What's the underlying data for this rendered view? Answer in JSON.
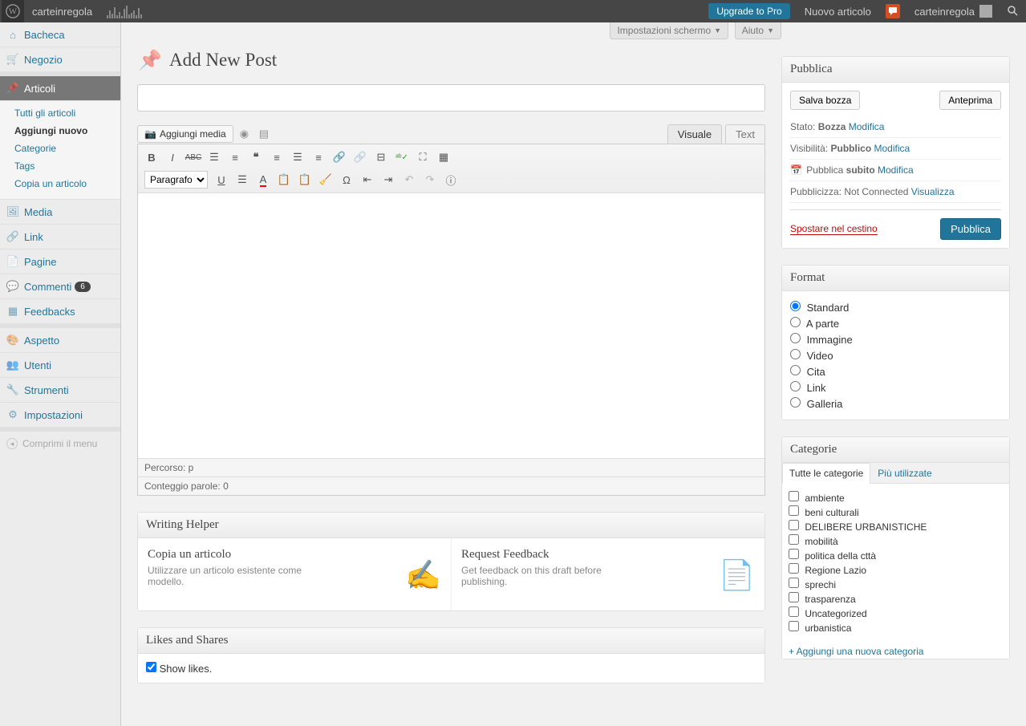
{
  "adminbar": {
    "sitename": "carteinregola",
    "upgrade": "Upgrade to Pro",
    "new_post": "Nuovo articolo",
    "username": "carteinregola"
  },
  "screen_meta": {
    "options": "Impostazioni schermo",
    "help": "Aiuto"
  },
  "sidebar": {
    "bacheca": "Bacheca",
    "negozio": "Negozio",
    "articoli": "Articoli",
    "sub_all": "Tutti gli articoli",
    "sub_add": "Aggiungi nuovo",
    "sub_cat": "Categorie",
    "sub_tags": "Tags",
    "sub_copy": "Copia un articolo",
    "media": "Media",
    "link": "Link",
    "pagine": "Pagine",
    "commenti": "Commenti",
    "commenti_count": "6",
    "feedbacks": "Feedbacks",
    "aspetto": "Aspetto",
    "utenti": "Utenti",
    "strumenti": "Strumenti",
    "impostazioni": "Impostazioni",
    "collapse": "Comprimi il menu"
  },
  "page": {
    "title": "Add New Post",
    "title_placeholder": ""
  },
  "editor": {
    "add_media": "Aggiungi media",
    "tab_visual": "Visuale",
    "tab_text": "Text",
    "paragraph": "Paragrafo",
    "path_label": "Percorso: p",
    "wordcount": "Conteggio parole: 0"
  },
  "writing_helper": {
    "title": "Writing Helper",
    "copy_title": "Copia un articolo",
    "copy_desc": "Utilizzare un articolo esistente come modello.",
    "feedback_title": "Request Feedback",
    "feedback_desc": "Get feedback on this draft before publishing."
  },
  "likes": {
    "title": "Likes and Shares",
    "show_likes": "Show likes."
  },
  "publish": {
    "title": "Pubblica",
    "save_draft": "Salva bozza",
    "preview": "Anteprima",
    "status_label": "Stato:",
    "status_value": "Bozza",
    "visibility_label": "Visibilità:",
    "visibility_value": "Pubblico",
    "schedule_label": "Pubblica",
    "schedule_value": "subito",
    "publicize_label": "Pubblicizza:",
    "publicize_value": "Not Connected",
    "edit": "Modifica",
    "view": "Visualizza",
    "trash": "Spostare nel cestino",
    "publish_btn": "Pubblica"
  },
  "format": {
    "title": "Format",
    "options": [
      "Standard",
      "A parte",
      "Immagine",
      "Video",
      "Cita",
      "Link",
      "Galleria"
    ]
  },
  "categories": {
    "title": "Categorie",
    "tab_all": "Tutte le categorie",
    "tab_most": "Più utilizzate",
    "items": [
      "ambiente",
      "beni culturali",
      "DELIBERE URBANISTICHE",
      "mobilità",
      "politica della cttà",
      "Regione Lazio",
      "sprechi",
      "trasparenza",
      "Uncategorized",
      "urbanistica"
    ],
    "add_new": "+ Aggiungi una nuova categoria"
  }
}
